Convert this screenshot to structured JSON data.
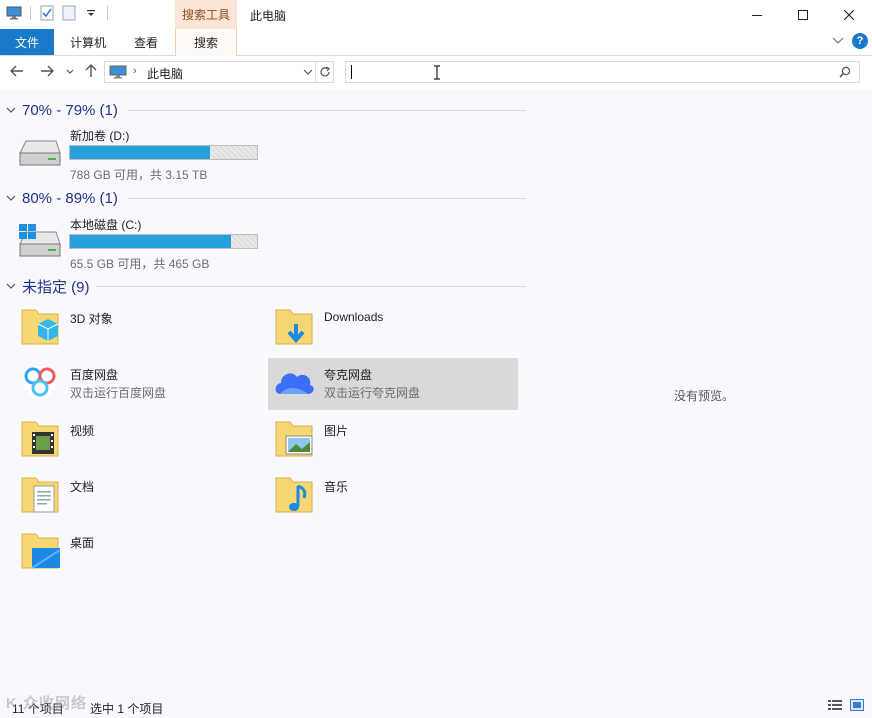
{
  "window": {
    "context_tab_group": "搜索工具",
    "title": "此电脑",
    "minimize": "—",
    "maximize": "☐",
    "close": "✕"
  },
  "ribbon": {
    "tabs": [
      {
        "label": "文件"
      },
      {
        "label": "计算机"
      },
      {
        "label": "查看"
      },
      {
        "label": "搜索"
      }
    ],
    "collapse": "⌄",
    "help": "?"
  },
  "nav": {
    "back": "←",
    "forward": "→",
    "recent": "⌄",
    "up": "↑",
    "address_path": "此电脑",
    "address_sep": "›",
    "address_drop": "⌄",
    "refresh": "↻",
    "search_value": ""
  },
  "groups": [
    {
      "label": "70% - 79% (1)"
    },
    {
      "label": "80% - 89% (1)"
    },
    {
      "label": "未指定 (9)"
    }
  ],
  "drives": [
    {
      "name": "新加卷 (D:)",
      "info": "788 GB 可用，共 3.15 TB",
      "used_fraction": 0.75
    },
    {
      "name": "本地磁盘 (C:)",
      "info": "65.5 GB 可用，共 465 GB",
      "used_fraction": 0.86
    }
  ],
  "items": [
    {
      "name": "3D 对象",
      "sub": ""
    },
    {
      "name": "Downloads",
      "sub": ""
    },
    {
      "name": "百度网盘",
      "sub": "双击运行百度网盘"
    },
    {
      "name": "夸克网盘",
      "sub": "双击运行夸克网盘"
    },
    {
      "name": "视频",
      "sub": ""
    },
    {
      "name": "图片",
      "sub": ""
    },
    {
      "name": "文档",
      "sub": ""
    },
    {
      "name": "音乐",
      "sub": ""
    },
    {
      "name": "桌面",
      "sub": ""
    }
  ],
  "preview": {
    "empty_text": "没有预览。"
  },
  "status": {
    "count": "11 个项目",
    "selection": "选中 1 个项目"
  },
  "watermark": "K 众收网络"
}
